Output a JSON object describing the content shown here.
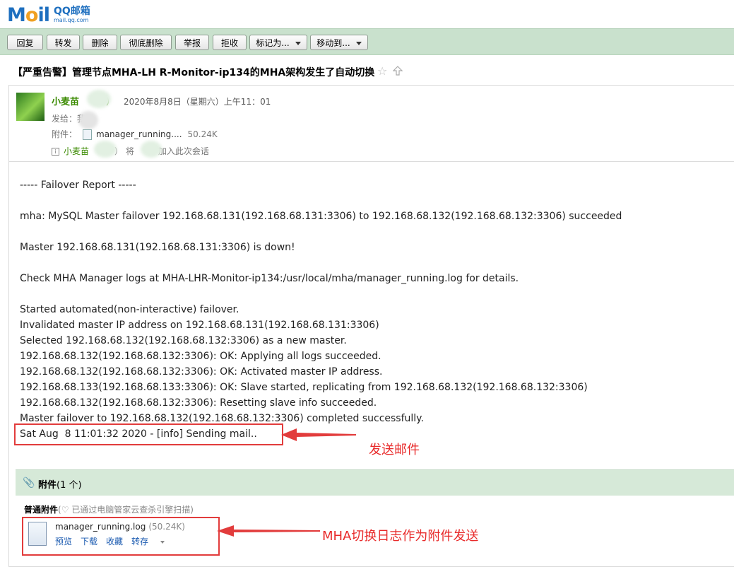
{
  "logo": {
    "mail": "Mail",
    "brand": "QQ邮箱",
    "domain": "mail.qq.com"
  },
  "toolbar": {
    "reply": "回复",
    "forward": "转发",
    "delete": "删除",
    "delete_permanently": "彻底删除",
    "report": "举报",
    "reject": "拒收",
    "mark_as": "标记为...",
    "move_to": "移动到..."
  },
  "subject": "【严重告警】管理节点MHA-LH R-Monitor-ip134的MHA架构发生了自动切换",
  "header": {
    "sender": "小麦苗",
    "sender_suffix": "）",
    "date": "2020年8月8日（星期六）上午11：01",
    "to_label": "发给：",
    "to_value": "我",
    "attachment_label": "附件：",
    "attachment_file": "manager_running....",
    "attachment_size": "50.24K",
    "info_sender": "小麦苗",
    "info_mid": "）  将",
    "info_action": "加入此次会话"
  },
  "body_lines": [
    "----- Failover Report -----",
    "",
    "mha: MySQL Master failover 192.168.68.131(192.168.68.131:3306) to 192.168.68.132(192.168.68.132:3306) succeeded",
    "",
    "Master 192.168.68.131(192.168.68.131:3306) is down!",
    "",
    "Check MHA Manager logs at MHA-LHR-Monitor-ip134:/usr/local/mha/manager_running.log for details.",
    "",
    "Started automated(non-interactive) failover.",
    "Invalidated master IP address on 192.168.68.131(192.168.68.131:3306)",
    "Selected 192.168.68.132(192.168.68.132:3306) as a new master.",
    "192.168.68.132(192.168.68.132:3306): OK: Applying all logs succeeded.",
    "192.168.68.132(192.168.68.132:3306): OK: Activated master IP address.",
    "192.168.68.133(192.168.68.133:3306): OK: Slave started, replicating from 192.168.68.132(192.168.68.132:3306)",
    "192.168.68.132(192.168.68.132:3306): Resetting slave info succeeded.",
    "Master failover to 192.168.68.132(192.168.68.132:3306) completed successfully.",
    "Sat Aug  8 11:01:32 2020 - [info] Sending mail.."
  ],
  "annotations": {
    "send_mail": "发送邮件",
    "attachment_note": "MHA切换日志作为附件发送"
  },
  "attachments": {
    "title": "附件",
    "count": "(1 个)",
    "normal_label": "普通附件",
    "scan_note": "(♡ 已通过电脑管家云查杀引擎扫描)",
    "file_name": "manager_running.log",
    "file_size": "(50.24K)",
    "actions": [
      "预览",
      "下载",
      "收藏",
      "转存"
    ]
  },
  "colors": {
    "toolbar_bg": "#c9e1cd",
    "annotation_red": "#e23c3c",
    "sender_green": "#3a8a00",
    "link_blue": "#1a5ab0"
  }
}
